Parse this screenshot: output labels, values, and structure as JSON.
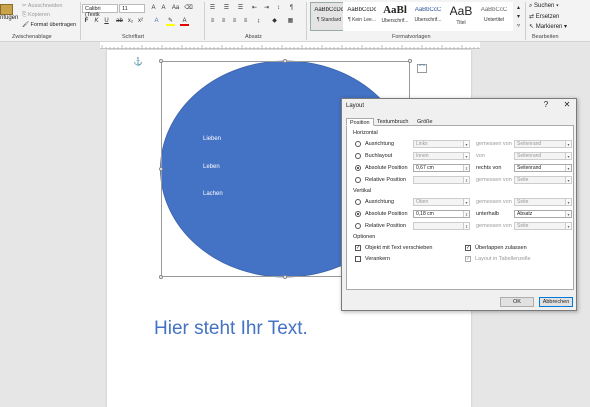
{
  "ribbon": {
    "clipboard": {
      "paste_label": "nfügen",
      "cut": "Ausschneiden",
      "copy": "Kopieren",
      "format_painter": "Format übertragen",
      "group": "Zwischenablage"
    },
    "font": {
      "family": "Calibri (Textk",
      "size": "11",
      "group": "Schriftart"
    },
    "paragraph": {
      "group": "Absatz"
    },
    "styles": {
      "items": [
        {
          "sample": "AaBbCcDc",
          "name": "¶ Standard"
        },
        {
          "sample": "AaBbCcDc",
          "name": "¶ Kein Lee..."
        },
        {
          "sample": "AaBl",
          "name": "Überschrif..."
        },
        {
          "sample": "AaBbCcC",
          "name": "Überschrif..."
        },
        {
          "sample": "AaB",
          "name": "Titel"
        },
        {
          "sample": "AaBbCcC",
          "name": "Untertitel"
        }
      ],
      "group": "Formatvorlagen"
    },
    "editing": {
      "find": "Suchen",
      "replace": "Ersetzen",
      "select": "Markieren",
      "group": "Bearbeiten"
    }
  },
  "document": {
    "ellipse_labels": [
      "Lieben",
      "Leben",
      "Lachen"
    ],
    "body_text": "Hier steht Ihr Text."
  },
  "dialog": {
    "title": "Layout",
    "help": "?",
    "close": "✕",
    "tabs": [
      "Position",
      "Textumbruch",
      "Größe"
    ],
    "horizontal": {
      "title": "Horizontal",
      "rows": [
        {
          "label": "Ausrichtung",
          "value": "Links",
          "rel_label": "gemessen von",
          "rel_value": "Seitenrand",
          "selected": false
        },
        {
          "label": "Buchlayout",
          "value": "Innen",
          "rel_label": "von",
          "rel_value": "Seitenrand",
          "selected": false
        },
        {
          "label": "Absolute Position",
          "value": "0,67 cm",
          "rel_label": "rechts von",
          "rel_value": "Seitenrand",
          "selected": true
        },
        {
          "label": "Relative Position",
          "value": "",
          "rel_label": "gemessen von",
          "rel_value": "Seite",
          "selected": false
        }
      ]
    },
    "vertical": {
      "title": "Vertikal",
      "rows": [
        {
          "label": "Ausrichtung",
          "value": "Oben",
          "rel_label": "gemessen von",
          "rel_value": "Seite",
          "selected": false
        },
        {
          "label": "Absolute Position",
          "value": "0,18 cm",
          "rel_label": "unterhalb",
          "rel_value": "Absatz",
          "selected": true
        },
        {
          "label": "Relative Position",
          "value": "",
          "rel_label": "gemessen von",
          "rel_value": "Seite",
          "selected": false
        }
      ]
    },
    "options": {
      "title": "Optionen",
      "items": [
        {
          "label": "Objekt mit Text verschieben",
          "checked": true,
          "disabled": false
        },
        {
          "label": "Verankern",
          "checked": false,
          "disabled": false
        },
        {
          "label": "Überlappen zulassen",
          "checked": true,
          "disabled": false
        },
        {
          "label": "Layout in Tabellenzelle",
          "checked": true,
          "disabled": true
        }
      ]
    },
    "ok": "OK",
    "cancel": "Abbrechen"
  }
}
